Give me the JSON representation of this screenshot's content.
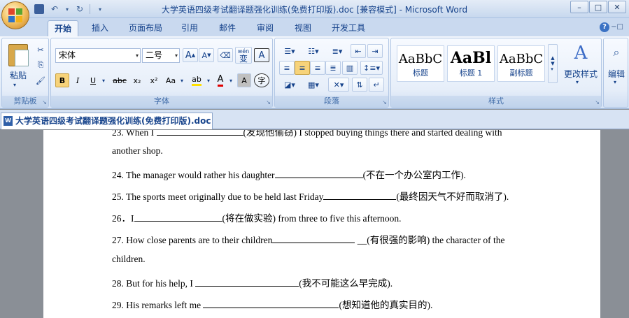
{
  "window": {
    "title": "大学英语四级考试翻译题强化训练(免费打印版).doc [兼容模式] - Microsoft Word"
  },
  "tabs": [
    "开始",
    "插入",
    "页面布局",
    "引用",
    "邮件",
    "审阅",
    "视图",
    "开发工具"
  ],
  "ribbon": {
    "clipboard": {
      "label": "剪贴板",
      "paste": "粘贴"
    },
    "font": {
      "label": "字体",
      "name": "宋体",
      "size": "二号",
      "phonetic": "wén",
      "phonetic_char": "变",
      "char_border": "A",
      "bold": "B",
      "italic": "I",
      "underline": "U",
      "strike": "abc",
      "sub": "x₂",
      "sup": "x²",
      "case": "Aa",
      "shade": "A",
      "enclose": "字"
    },
    "paragraph": {
      "label": "段落"
    },
    "styles": {
      "label": "样式",
      "items": [
        {
          "sample": "AaBbC",
          "name": "标题"
        },
        {
          "sample": "AaBl",
          "name": "标题 1"
        },
        {
          "sample": "AaBbC",
          "name": "副标题"
        }
      ],
      "change": "更改样式"
    },
    "editing": {
      "label": "编辑"
    }
  },
  "document": {
    "tab_title": "大学英语四级考试翻译题强化训练(免费打印版).doc",
    "lines": [
      {
        "pre": "23. When I ",
        "post": "(发现他偷窃) I stopped buying things there and started dealing with"
      },
      {
        "pre": "another shop.",
        "post": ""
      },
      {
        "pre": "24. The manager would rather his daughter",
        "post": "(不在一个办公室内工作)."
      },
      {
        "pre": "25. The sports meet originally due to be held last Friday",
        "post": "(最终因天气不好而取消了)."
      },
      {
        "pre": "26．I",
        "post": "(将在做实验) from three to five this afternoon."
      },
      {
        "pre": "27. How close parents are to their children",
        "post": " __(有很强的影响) the character of the"
      },
      {
        "pre": "children.",
        "post": ""
      },
      {
        "pre": "28. But for his help, I ",
        "post": "(我不可能这么早完成)."
      },
      {
        "pre": "29. His remarks left me ",
        "post": "(想知道他的真实目的)."
      }
    ]
  }
}
